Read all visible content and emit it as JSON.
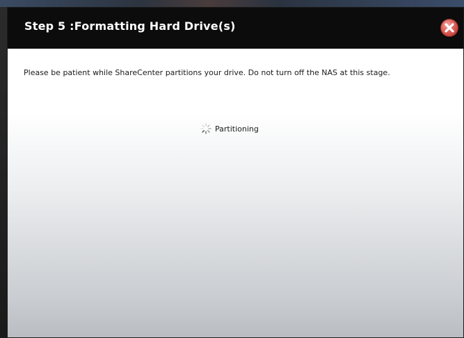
{
  "dialog": {
    "title": "Step 5 :Formatting Hard Drive(s)",
    "message": "Please be patient while ShareCenter partitions your drive. Do not turn off the NAS at this stage.",
    "status_text": "Partitioning",
    "close_icon": "close-icon",
    "spinner_icon": "loading-spinner-icon"
  },
  "colors": {
    "titlebar_bg": "#0c0c0c",
    "title_text": "#ffffff",
    "close_button": "#d9534f"
  }
}
